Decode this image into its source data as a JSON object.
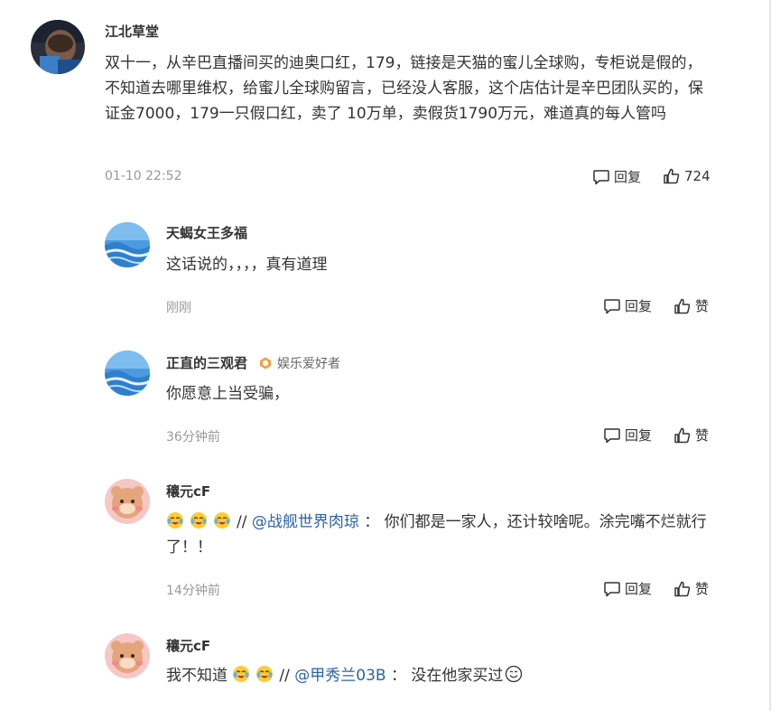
{
  "comments": [
    {
      "author": "江北草堂",
      "text": "双十一，从辛巴直播间买的迪奥口红，179，链接是天猫的蜜儿全球购，专柜说是假的，不知道去哪里维权，给蜜儿全球购留言，已经没人客服，这个店估计是辛巴团队买的，保证金7000，179一只假口红，卖了 10万单，卖假货1790万元，难道真的每人管吗",
      "time": "01-10 22:52",
      "reply_label": "回复",
      "like_label": "724"
    }
  ],
  "replies": [
    {
      "author": "天蝎女王多福",
      "text": "这话说的，，，，真有道理",
      "time": "刚刚",
      "reply_label": "回复",
      "like_label": "赞"
    },
    {
      "author": "正直的三观君",
      "tag": "娱乐爱好者",
      "text": "你愿意上当受骗，",
      "time": "36分钟前",
      "reply_label": "回复",
      "like_label": "赞"
    },
    {
      "author": "穰元cF",
      "text_sep": "//",
      "mention": "@战舰世界肉琼",
      "text_after": "：  你们都是一家人，还计较啥呢。涂完嘴不烂就行了！！",
      "time": "14分钟前",
      "reply_label": "回复",
      "like_label": "赞"
    },
    {
      "author": "穰元cF",
      "text_before": "我不知道",
      "text_sep": "//",
      "mention": "@甲秀兰03B",
      "text_after": "：  没在他家买过"
    }
  ],
  "colors": {
    "text": "#333333",
    "meta": "#999999",
    "mention": "#2b63a6"
  },
  "icons": [
    "comment-icon",
    "thumbs-up-icon",
    "crying-laugh-emoji",
    "smile-emoji",
    "hexagon-badge-icon"
  ]
}
